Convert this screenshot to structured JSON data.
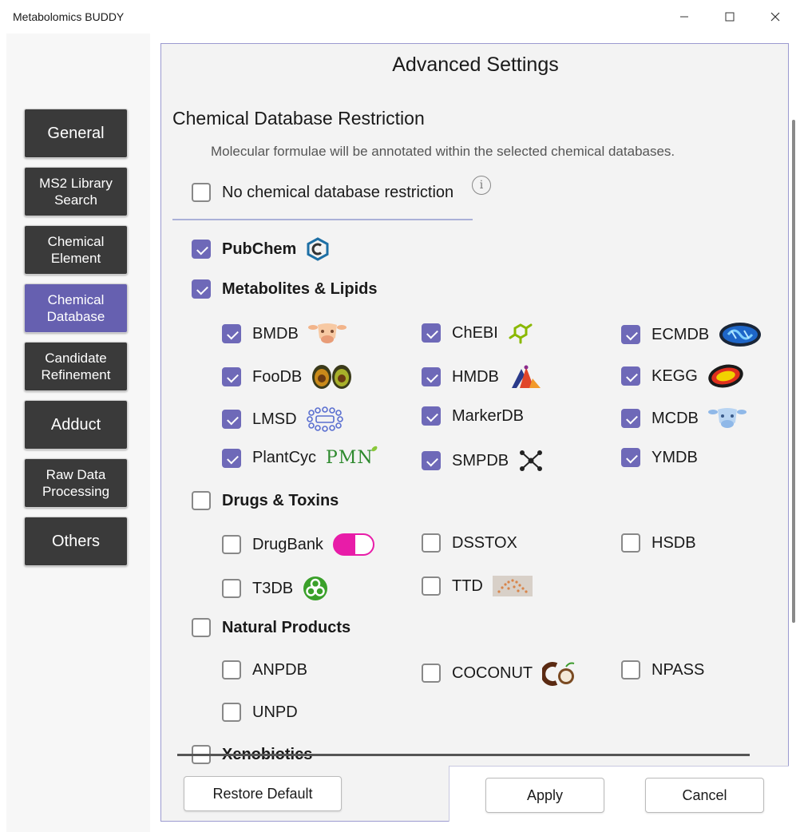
{
  "window": {
    "title": "Metabolomics BUDDY"
  },
  "nav": {
    "items": [
      {
        "label": "General"
      },
      {
        "label": "MS2 Library Search"
      },
      {
        "label": "Chemical Element"
      },
      {
        "label": "Chemical Database"
      },
      {
        "label": "Candidate Refinement"
      },
      {
        "label": "Adduct"
      },
      {
        "label": "Raw Data Processing"
      },
      {
        "label": "Others"
      }
    ],
    "active": "Chemical Database"
  },
  "panel": {
    "title": "Advanced Settings",
    "section_title": "Chemical Database Restriction",
    "description": "Molecular formulae will be annotated within the selected chemical databases.",
    "no_restriction": {
      "label": "No chemical database restriction",
      "checked": false
    },
    "pubchem": {
      "label": "PubChem",
      "checked": true
    },
    "groups": {
      "metabolites": {
        "label": "Metabolites & Lipids",
        "checked": true,
        "items": {
          "bmdb": {
            "label": "BMDB",
            "checked": true
          },
          "chebi": {
            "label": "ChEBI",
            "checked": true
          },
          "ecmdb": {
            "label": "ECMDB",
            "checked": true
          },
          "foodb": {
            "label": "FooDB",
            "checked": true
          },
          "hmdb": {
            "label": "HMDB",
            "checked": true
          },
          "kegg": {
            "label": "KEGG",
            "checked": true
          },
          "lmsd": {
            "label": "LMSD",
            "checked": true
          },
          "markerdb": {
            "label": "MarkerDB",
            "checked": true
          },
          "mcdb": {
            "label": "MCDB",
            "checked": true
          },
          "plantcyc": {
            "label": "PlantCyc",
            "checked": true
          },
          "smpdb": {
            "label": "SMPDB",
            "checked": true
          },
          "ymdb": {
            "label": "YMDB",
            "checked": true
          }
        }
      },
      "drugs": {
        "label": "Drugs & Toxins",
        "checked": false,
        "items": {
          "drugbank": {
            "label": "DrugBank",
            "checked": false
          },
          "dsstox": {
            "label": "DSSTOX",
            "checked": false
          },
          "hsdb": {
            "label": "HSDB",
            "checked": false
          },
          "t3db": {
            "label": "T3DB",
            "checked": false
          },
          "ttd": {
            "label": "TTD",
            "checked": false
          }
        }
      },
      "natural": {
        "label": "Natural Products",
        "checked": false,
        "items": {
          "anpdb": {
            "label": "ANPDB",
            "checked": false
          },
          "coconut": {
            "label": "COCONUT",
            "checked": false
          },
          "npass": {
            "label": "NPASS",
            "checked": false
          },
          "unpd": {
            "label": "UNPD",
            "checked": false
          }
        }
      },
      "xenobiotics": {
        "label": "Xenobiotics",
        "checked": false
      }
    },
    "logo_text": {
      "pmn": "PMN"
    }
  },
  "footer": {
    "restore_label": "Restore Default",
    "apply_label": "Apply",
    "cancel_label": "Cancel"
  },
  "colors": {
    "accent": "#6e69b8",
    "nav_active": "#6660b0",
    "nav_button": "#3a3a3a"
  }
}
